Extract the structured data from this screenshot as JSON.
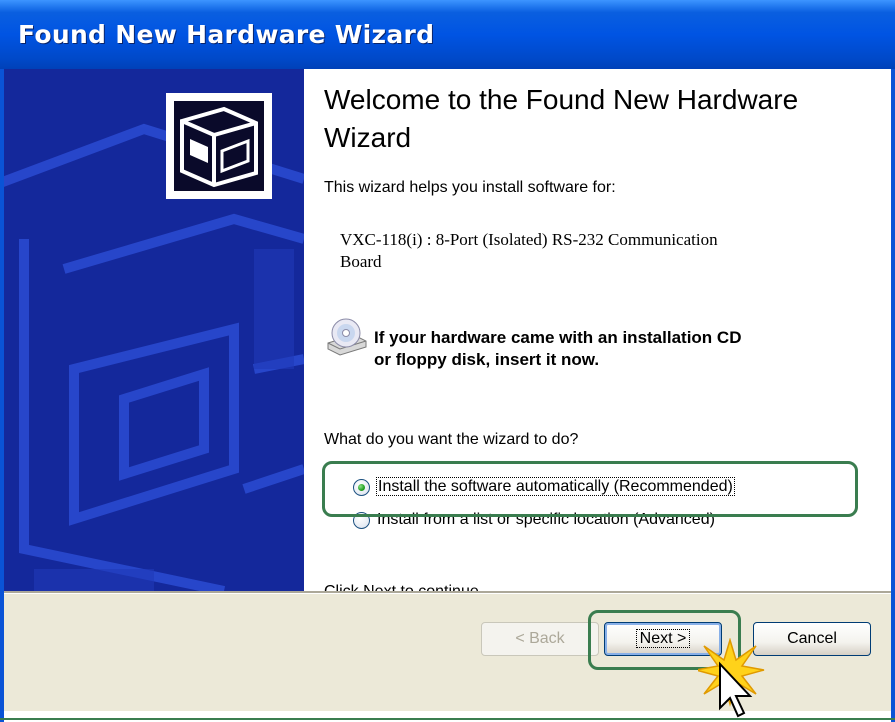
{
  "window": {
    "title": "Found New Hardware Wizard"
  },
  "main": {
    "heading": "Welcome to the Found New Hardware Wizard",
    "intro": "This wizard helps you install software for:",
    "device_line1": "VXC-118(i) : 8-Port (Isolated) RS-232 Communication",
    "device_line2": "Board",
    "cd_line1": "If your hardware came with an installation CD",
    "cd_line2": "or floppy disk, insert it now.",
    "question": "What do you want the wizard to do?",
    "options": [
      {
        "label": "Install the software automatically (Recommended)",
        "selected": true
      },
      {
        "label": "Install from a list or specific location (Advanced)",
        "selected": false
      }
    ],
    "continue_text": "Click Next to continue."
  },
  "buttons": {
    "back": "< Back",
    "next": "Next >",
    "cancel": "Cancel"
  },
  "colors": {
    "titlebar": "#0054e3",
    "side_panel": "#14289b",
    "highlight": "#3a7d4f"
  }
}
